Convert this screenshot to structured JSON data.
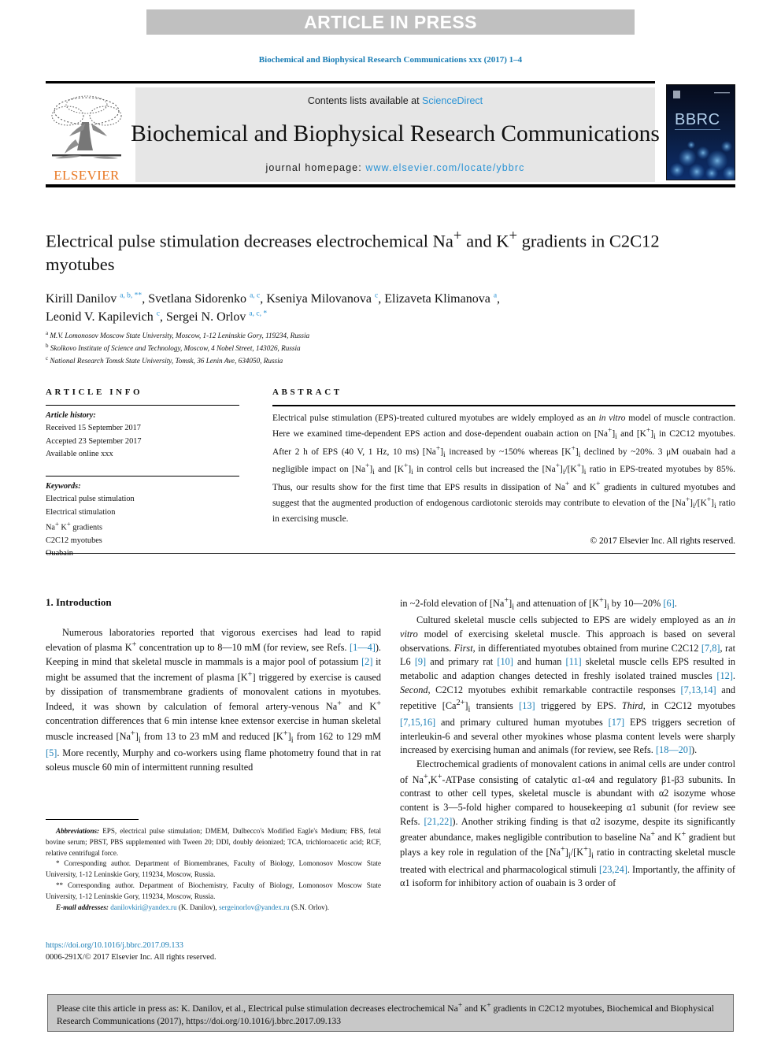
{
  "banner": {
    "label": "ARTICLE IN PRESS"
  },
  "running_head": "Biochemical and Biophysical Research Communications xxx (2017) 1–4",
  "masthead": {
    "contents_prefix": "Contents lists available at ",
    "sciencedirect": "ScienceDirect",
    "journal_title": "Biochemical and Biophysical Research Communications",
    "homepage_prefix": "journal homepage: ",
    "homepage_url": "www.elsevier.com/locate/ybbrc",
    "publisher": "ELSEVIER",
    "cover_label": "BBRC",
    "colors": {
      "link": "#2a93d5",
      "elsevier_orange": "#e87722",
      "banner_gray": "#c0c0c0",
      "mast_gray": "#e6e6e6"
    }
  },
  "article": {
    "title": "Electrical pulse stimulation decreases electrochemical Na+ and K+ gradients in C2C12 myotubes",
    "authors_html": "Kirill Danilov <sup>a, b, **</sup>, Svetlana Sidorenko <sup>a, c</sup>, Kseniya Milovanova <sup>c</sup>, Elizaveta Klimanova <sup>a</sup>, Leonid V. Kapilevich <sup>c</sup>, Sergei N. Orlov <sup>a, c, *</sup>",
    "affiliations": [
      {
        "mark": "a",
        "text": "M.V. Lomonosov Moscow State University, Moscow, 1-12 Leninskie Gory, 119234, Russia"
      },
      {
        "mark": "b",
        "text": "Skolkovo Institute of Science and Technology, Moscow, 4 Nobel Street, 143026, Russia"
      },
      {
        "mark": "c",
        "text": "National Research Tomsk State University, Tomsk, 36 Lenin Ave, 634050, Russia"
      }
    ]
  },
  "article_info": {
    "heading": "ARTICLE INFO",
    "history_label": "Article history:",
    "history": [
      "Received 15 September 2017",
      "Accepted 23 September 2017",
      "Available online xxx"
    ],
    "keywords_label": "Keywords:",
    "keywords": [
      "Electrical pulse stimulation",
      "Electrical stimulation",
      "Na+ K+ gradients",
      "C2C12 myotubes",
      "Ouabain"
    ]
  },
  "abstract": {
    "heading": "ABSTRACT",
    "text": "Electrical pulse stimulation (EPS)-treated cultured myotubes are widely employed as an in vitro model of muscle contraction. Here we examined time-dependent EPS action and dose-dependent ouabain action on [Na+]i and [K+]i in C2C12 myotubes. After 2 h of EPS (40 V, 1 Hz, 10 ms) [Na+]i increased by ~150% whereas [K+]i declined by ~20%. 3 μM ouabain had a negligible impact on [Na+]i and [K+]i in control cells but increased the [Na+]i/[K+]i ratio in EPS-treated myotubes by 85%. Thus, our results show for the first time that EPS results in dissipation of Na+ and K+ gradients in cultured myotubes and suggest that the augmented production of endogenous cardiotonic steroids may contribute to elevation of the [Na+]i/[K+]i ratio in exercising muscle.",
    "copyright": "© 2017 Elsevier Inc. All rights reserved."
  },
  "body": {
    "section_heading": "1. Introduction",
    "left_paragraph": "Numerous laboratories reported that vigorous exercises had lead to rapid elevation of plasma K+ concentration up to 8–10 mM (for review, see Refs. [1–4]). Keeping in mind that skeletal muscle in mammals is a major pool of potassium [2] it might be assumed that the increment of plasma [K+] triggered by exercise is caused by dissipation of transmembrane gradients of monovalent cations in myotubes. Indeed, it was shown by calculation of femoral artery-venous Na+ and K+ concentration differences that 6 min intense knee extensor exercise in human skeletal muscle increased [Na+]i from 13 to 23 mM and reduced [K+]i from 162 to 129 mM [5]. More recently, Murphy and co-workers using flame photometry found that in rat soleus muscle 60 min of intermittent running resulted",
    "right_paragraph_1": "in ~2-fold elevation of [Na+]i and attenuation of [K+]i by 10–20% [6].",
    "right_paragraph_2": "Cultured skeletal muscle cells subjected to EPS are widely employed as an in vitro model of exercising skeletal muscle. This approach is based on several observations. First, in differentiated myotubes obtained from murine C2C12 [7,8], rat L6 [9] and primary rat [10] and human [11] skeletal muscle cells EPS resulted in metabolic and adaption changes detected in freshly isolated trained muscles [12]. Second, C2C12 myotubes exhibit remarkable contractile responses [7,13,14] and repetitive [Ca2+]i transients [13] triggered by EPS. Third, in C2C12 myotubes [7,15,16] and primary cultured human myotubes [17] EPS triggers secretion of interleukin-6 and several other myokines whose plasma content levels were sharply increased by exercising human and animals (for review, see Refs. [18–20]).",
    "right_paragraph_3": "Electrochemical gradients of monovalent cations in animal cells are under control of Na+,K+-ATPase consisting of catalytic α1-α4 and regulatory β1-β3 subunits. In contrast to other cell types, skeletal muscle is abundant with α2 isozyme whose content is 3–5-fold higher compared to housekeeping α1 subunit (for review see Refs. [21,22]). Another striking finding is that α2 isozyme, despite its significantly greater abundance, makes negligible contribution to baseline Na+ and K+ gradient but plays a key role in regulation of the [Na+]i/[K+]i ratio in contracting skeletal muscle treated with electrical and pharmacological stimuli [23,24]. Importantly, the affinity of α1 isoform for inhibitory action of ouabain is 3 order of"
  },
  "footnotes": {
    "abbreviations_label": "Abbreviations:",
    "abbreviations_text": "EPS, electrical pulse stimulation; DMEM, Dulbecco's Modified Eagle's Medium; FBS, fetal bovine serum; PBST, PBS supplemented with Tween 20; DDI, doubly deionized; TCA, trichloroacetic acid; RCF, relative centrifugal force.",
    "corresponding_1": "* Corresponding author. Department of Biomembranes, Faculty of Biology, Lomonosov Moscow State University, 1-12 Leninskie Gory, 119234, Moscow, Russia.",
    "corresponding_2": "** Corresponding author. Department of Biochemistry, Faculty of Biology, Lomonosov Moscow State University, 1-12 Leninskie Gory, 119234, Moscow, Russia.",
    "email_label": "E-mail addresses:",
    "email_1": "danilovkiri@yandex.ru",
    "email_1_owner": "(K. Danilov),",
    "email_2": "sergeinorlov@yandex.ru",
    "email_2_owner": "(S.N. Orlov)."
  },
  "doi_block": {
    "doi": "https://doi.org/10.1016/j.bbrc.2017.09.133",
    "issn_line": "0006-291X/© 2017 Elsevier Inc. All rights reserved."
  },
  "cite_box": {
    "text": "Please cite this article in press as: K. Danilov, et al., Electrical pulse stimulation decreases electrochemical Na+ and K+ gradients in C2C12 myotubes, Biochemical and Biophysical Research Communications (2017), https://doi.org/10.1016/j.bbrc.2017.09.133"
  }
}
